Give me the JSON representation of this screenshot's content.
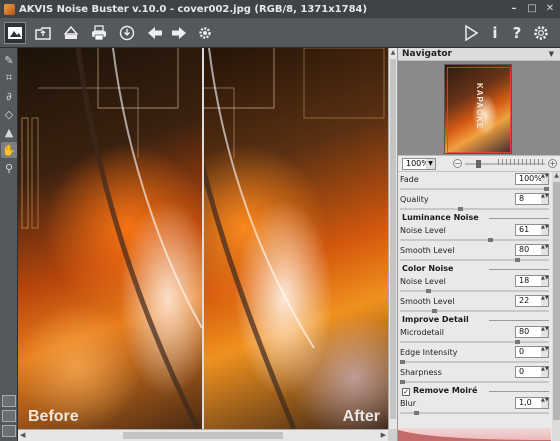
{
  "window": {
    "title": "AKVIS Noise Buster v.10.0 - cover002.jpg (RGB/8, 1371x1784)",
    "controls": [
      "–",
      "□",
      "✕"
    ]
  },
  "toolbar": {
    "left_icons": [
      "photo-icon",
      "open-icon",
      "save-icon",
      "print-icon",
      "share-icon",
      "undo-arrow-icon",
      "redo-arrow-icon",
      "settings-gear-icon"
    ],
    "right_icons": [
      "run-play-icon",
      "info-icon",
      "help-icon",
      "preferences-gear-icon"
    ]
  },
  "tools": [
    "brush-icon",
    "crop-icon",
    "lasso-icon",
    "eraser-icon",
    "stamp-icon",
    "hand-icon",
    "zoom-icon"
  ],
  "viewer": {
    "before_label": "Before",
    "after_label": "After"
  },
  "navigator": {
    "title": "Navigator",
    "thumbnail_text": "KAPAOKE",
    "zoom": "100%",
    "zoom_level": 1.0
  },
  "params": {
    "fade": {
      "label": "Fade",
      "value": "100%",
      "level": 1.0
    },
    "quality": {
      "label": "Quality",
      "value": "8",
      "level": 0.4
    },
    "luminance_title": "Luminance Noise",
    "lum_noise": {
      "label": "Noise Level",
      "value": "61",
      "level": 0.61
    },
    "lum_smooth": {
      "label": "Smooth Level",
      "value": "80",
      "level": 0.8
    },
    "color_title": "Color Noise",
    "col_noise": {
      "label": "Noise Level",
      "value": "18",
      "level": 0.18
    },
    "col_smooth": {
      "label": "Smooth Level",
      "value": "22",
      "level": 0.22
    },
    "detail_title": "Improve Detail",
    "microdetail": {
      "label": "Microdetail",
      "value": "80",
      "level": 0.8
    },
    "edge": {
      "label": "Edge Intensity",
      "value": "0",
      "level": 0.0
    },
    "sharpness": {
      "label": "Sharpness",
      "value": "0",
      "level": 0.0
    },
    "moire_title": "Remove Moiré",
    "moire_checked": true,
    "blur": {
      "label": "Blur",
      "value": "1,0",
      "level": 0.1
    }
  }
}
